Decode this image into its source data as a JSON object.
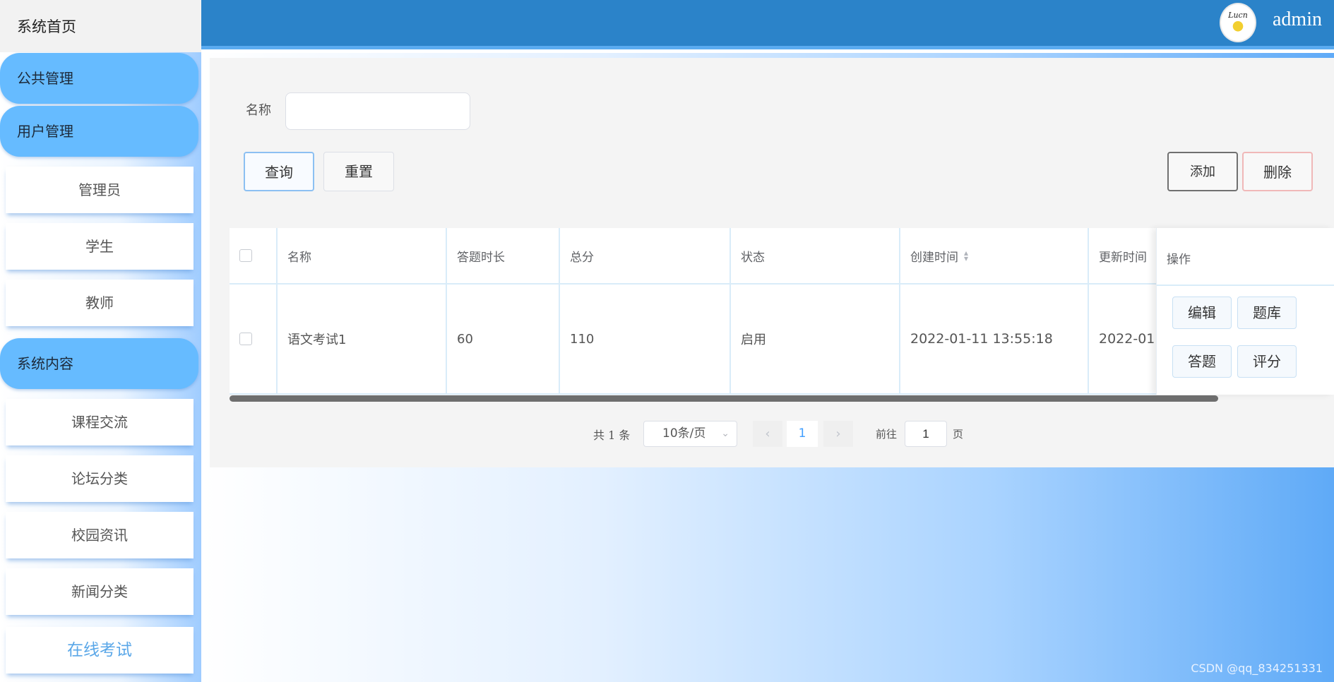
{
  "sidebar": {
    "home_label": "系统首页",
    "groups": [
      {
        "label": "公共管理"
      },
      {
        "label": "用户管理",
        "items": [
          {
            "label": "管理员"
          },
          {
            "label": "学生"
          },
          {
            "label": "教师"
          }
        ]
      },
      {
        "label": "系统内容",
        "items": [
          {
            "label": "课程交流"
          },
          {
            "label": "论坛分类"
          },
          {
            "label": "校园资讯"
          },
          {
            "label": "新闻分类"
          },
          {
            "label": "在线考试"
          }
        ]
      }
    ]
  },
  "header": {
    "avatar_text": "Lucn",
    "username": "admin"
  },
  "search": {
    "label": "名称",
    "value": ""
  },
  "toolbar": {
    "query_label": "查询",
    "reset_label": "重置",
    "add_label": "添加",
    "delete_label": "删除"
  },
  "table": {
    "columns": [
      "名称",
      "答题时长",
      "总分",
      "状态",
      "创建时间",
      "更新时间",
      "操作"
    ],
    "rows": [
      {
        "name": "语文考试1",
        "duration": "60",
        "total": "110",
        "status": "启用",
        "created": "2022-01-11 13:55:18",
        "updated": "2022-01",
        "actions": [
          "编辑",
          "题库",
          "答题",
          "评分"
        ]
      }
    ]
  },
  "pagination": {
    "total_text": "共 1 条",
    "page_size": "10条/页",
    "current_page": "1",
    "goto_label": "前往",
    "goto_value": "1",
    "page_suffix": "页"
  },
  "watermark": "CSDN @qq_834251331",
  "colors": {
    "topbar": "#2b83c9",
    "sidebar_group": "#66bbff",
    "accent": "#409eff"
  }
}
